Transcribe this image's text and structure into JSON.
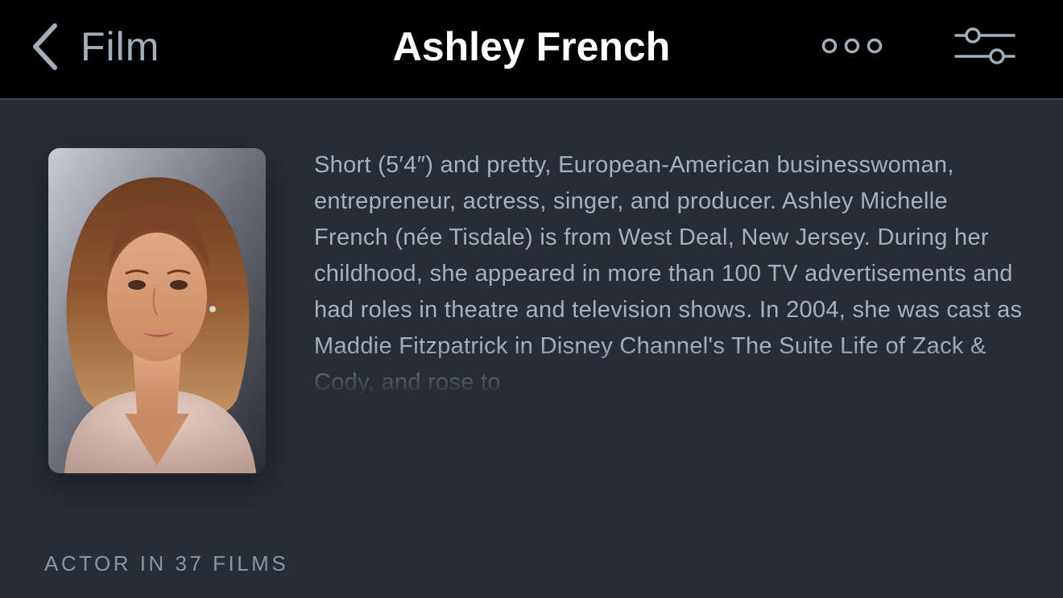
{
  "nav": {
    "back_label": "Film",
    "title": "Ashley French",
    "more_icon": "ellipsis-icon",
    "filter_icon": "sliders-icon"
  },
  "person": {
    "photo_icon": "actor-portrait",
    "bio": "Short (5′4″) and pretty, European-American businesswoman, entrepreneur, actress, singer, and producer. Ashley Michelle French (née Tisdale) is from West Deal, New Jersey. During her childhood, she appeared in more than 100 TV advertisements and had roles in theatre and television shows. In 2004, she was cast as Maddie Fitzpatrick in Disney Channel's The Suite Life of Zack & Cody, and rose to"
  },
  "filmography": {
    "heading": "ACTOR IN 37 FILMS"
  },
  "colors": {
    "background": "#262d36",
    "nav_background": "#000000",
    "accent": "#a3aebb",
    "title": "#ffffff"
  }
}
